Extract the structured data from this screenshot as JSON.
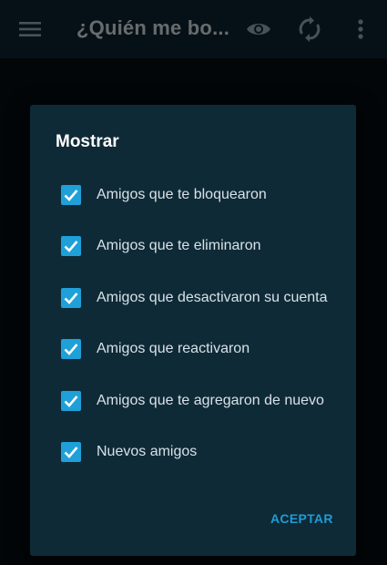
{
  "app_bar": {
    "title": "¿Quién me bo...",
    "icons": [
      "menu-icon",
      "eye-icon",
      "sync-icon",
      "more-vert-icon"
    ]
  },
  "dialog": {
    "title": "Mostrar",
    "options": [
      {
        "label": "Amigos que te bloquearon",
        "checked": true
      },
      {
        "label": "Amigos que te eliminaron",
        "checked": true
      },
      {
        "label": "Amigos que desactivaron su cuenta",
        "checked": true
      },
      {
        "label": "Amigos que reactivaron",
        "checked": true
      },
      {
        "label": "Amigos que te agregaron de nuevo",
        "checked": true
      },
      {
        "label": "Nuevos amigos",
        "checked": true
      }
    ],
    "accept_label": "ACEPTAR"
  },
  "colors": {
    "accent": "#1fa0d8",
    "dialog_bg": "#0f2a37",
    "appbar_bg": "#0d2733"
  }
}
